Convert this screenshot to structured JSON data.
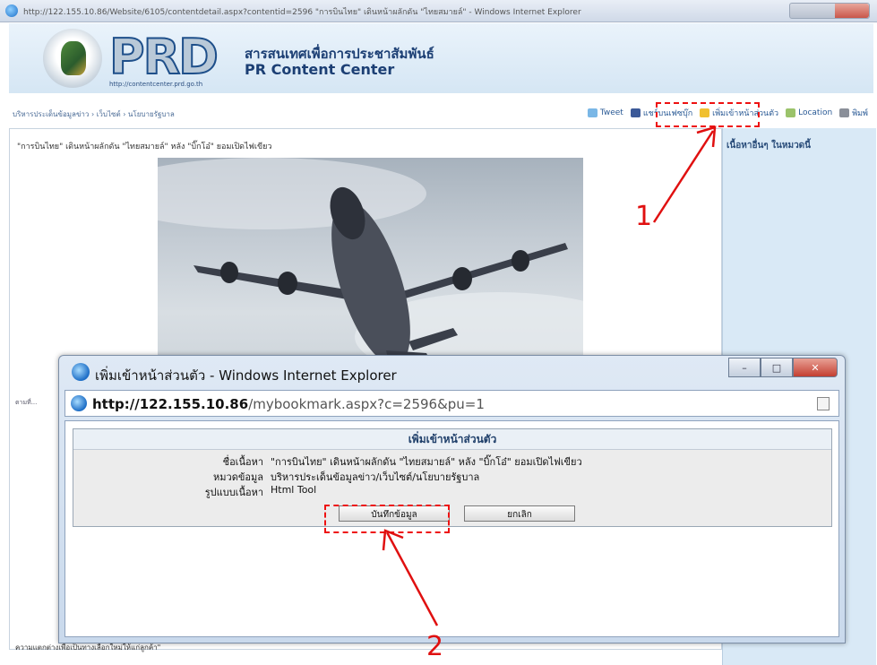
{
  "background_window": {
    "title": "http://122.155.10.86/Website/6105/contentdetail.aspx?contentid=2596 \"การบินไทย\" เดินหน้าผลักดัน \"ไทยสมายล์\" - Windows Internet Explorer"
  },
  "site": {
    "logo_text": "PRD",
    "logo_url": "http://contentcenter.prd.go.th",
    "title_thai": "สารสนเทศเพื่อการประชาสัมพันธ์",
    "title_en": "PR Content Center"
  },
  "nav": {
    "breadcrumb": "บริหารประเด็นข้อมูลข่าว › เว็บไซต์ › นโยบายรัฐบาล",
    "toolbar": {
      "tweet": "Tweet",
      "facebook": "แชร์บนเฟซบุ๊ก",
      "add_personal": "เพิ่มเข้าหน้าส่วนตัว",
      "location": "Location",
      "print": "พิมพ์"
    }
  },
  "article": {
    "title": "\"การบินไทย\" เดินหน้าผลักดัน \"ไทยสมายล์\" หลัง \"บิ๊กโอ๋\" ยอมเปิดไฟเขียว",
    "footer_fragment": "ความแตกต่างเพื่อเป็นทางเลือกใหม่ให้แก่ลูกค้า\""
  },
  "sidebar": {
    "title": "เนื้อหาอื่นๆ ในหมวดนี้"
  },
  "dialog": {
    "title": "เพิ่มเข้าหน้าส่วนตัว - Windows Internet Explorer",
    "address_host": "http://122.155.10.86",
    "address_path": "/mybookmark.aspx?c=2596&pu=1",
    "heading": "เพิ่มเข้าหน้าส่วนตัว",
    "fields": [
      {
        "label": "ชื่อเนื้อหา",
        "value": "\"การบินไทย\" เดินหน้าผลักดัน \"ไทยสมายล์\" หลัง \"บิ๊กโอ๋\" ยอมเปิดไฟเขียว"
      },
      {
        "label": "หมวดข้อมูล",
        "value": "บริหารประเด็นข้อมูลข่าว/เว็บไซต์/นโยบายรัฐบาล"
      },
      {
        "label": "รูปแบบเนื้อหา",
        "value": "Html Tool"
      }
    ],
    "save_button": "บันทึกข้อมูล",
    "cancel_button": "ยกเลิก"
  },
  "annotations": {
    "step1": "1",
    "step2": "2"
  },
  "colors": {
    "annotation": "#e01010",
    "header_blue": "#1c3f74"
  }
}
